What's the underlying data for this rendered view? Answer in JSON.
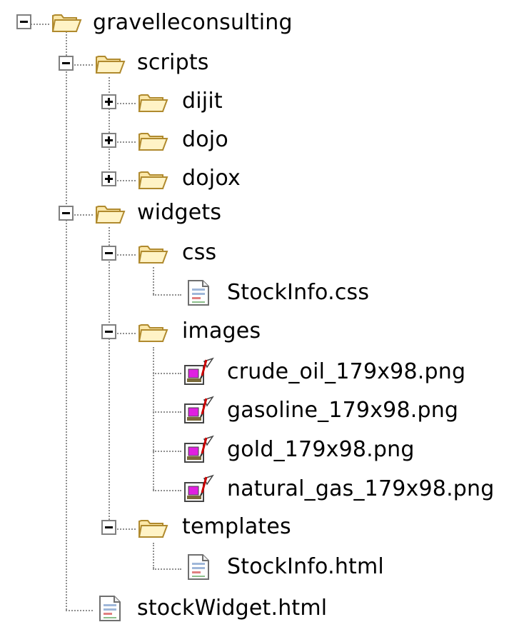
{
  "tree": {
    "root": {
      "label": "gravelleconsulting",
      "icon": "open-folder-icon",
      "children": {
        "scripts": {
          "label": "scripts",
          "icon": "open-folder-icon",
          "children": {
            "dijit": {
              "label": "dijit",
              "icon": "open-folder-icon",
              "collapsed": true
            },
            "dojo": {
              "label": "dojo",
              "icon": "open-folder-icon",
              "collapsed": true
            },
            "dojox": {
              "label": "dojox",
              "icon": "open-folder-icon",
              "collapsed": true
            }
          }
        },
        "widgets": {
          "label": "widgets",
          "icon": "open-folder-icon",
          "children": {
            "css": {
              "label": "css",
              "icon": "open-folder-icon",
              "files": [
                "StockInfo.css"
              ]
            },
            "images": {
              "label": "images",
              "icon": "open-folder-icon",
              "files": [
                "crude_oil_179x98.png",
                "gasoline_179x98.png",
                "gold_179x98.png",
                "natural_gas_179x98.png"
              ]
            },
            "templates": {
              "label": "templates",
              "icon": "open-folder-icon",
              "files": [
                "StockInfo.html"
              ]
            }
          }
        },
        "files": [
          "stockWidget.html"
        ]
      }
    },
    "icons": {
      "text_file": "text-file-icon",
      "image_file": "image-file-icon",
      "expand": "plus-icon",
      "collapse": "minus-icon"
    },
    "colors": {
      "folder_fill": "#fbe7a8",
      "folder_stroke": "#b08a2e",
      "connector": "#8f8f8f",
      "toggle_border": "#808080"
    }
  }
}
